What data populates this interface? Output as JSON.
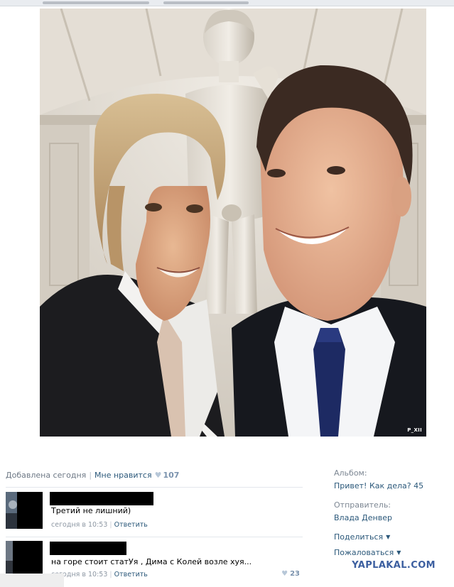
{
  "photo": {
    "watermark": "P_XII",
    "alt": "Селфи двух мужчин на фоне статуи"
  },
  "post_meta": {
    "added": "Добавлена сегодня",
    "like_label": "Мне нравится",
    "like_count": "107"
  },
  "comments": [
    {
      "text": "Третий не лишний)",
      "time": "сегодня в 10:53",
      "reply": "Ответить",
      "likes": ""
    },
    {
      "text": "на горе стоит статУя , Дима с Колей возле хуя...",
      "time": "сегодня в 10:53",
      "reply": "Ответить",
      "likes": "23"
    }
  ],
  "sidebar": {
    "album_label": "Альбом:",
    "album_value": "Привет! Как дела? 45",
    "sender_label": "Отправитель:",
    "sender_value": "Влада Денвер",
    "share": "Поделиться",
    "report": "Пожаловаться"
  },
  "site_mark": "YAPLAKAL.COM",
  "colors": {
    "link": "#2b587a",
    "muted": "#6d7885",
    "site_mark": "#3c5fa0"
  }
}
